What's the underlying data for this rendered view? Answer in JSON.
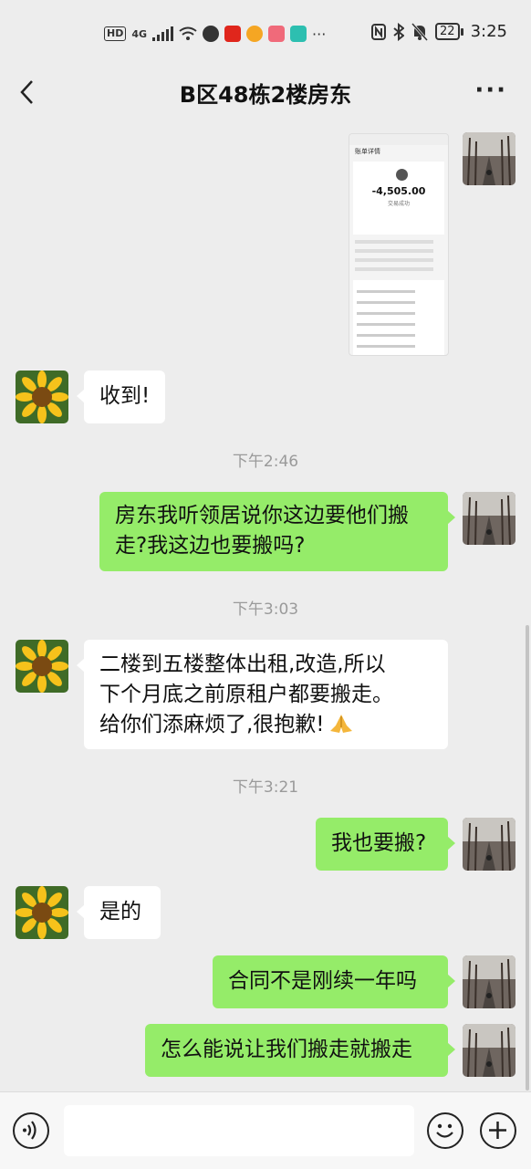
{
  "status_bar": {
    "left_badges": [
      "HD",
      "4G"
    ],
    "battery": "22",
    "time": "3:25",
    "more_indicator": "···"
  },
  "header": {
    "title": "B区48栋2楼房东",
    "more": "···"
  },
  "thumbnail": {
    "header": "账单详情",
    "amount": "-4,505.00",
    "status": "交易成功"
  },
  "messages": [
    {
      "side": "left",
      "text": "收到!"
    },
    {
      "timestamp": "下午2:46"
    },
    {
      "side": "right",
      "lines": [
        "房东我听领居说你这边要他们搬",
        "走?我这边也要搬吗?"
      ]
    },
    {
      "timestamp": "下午3:03"
    },
    {
      "side": "left",
      "lines": [
        "二楼到五楼整体出租,改造,所以",
        "下个月底之前原租户都要搬走。",
        "给你们添麻烦了,很抱歉!"
      ]
    },
    {
      "timestamp": "下午3:21"
    },
    {
      "side": "right",
      "text": "我也要搬?"
    },
    {
      "side": "left",
      "text": "是的"
    },
    {
      "side": "right",
      "text": "合同不是刚续一年吗"
    },
    {
      "side": "right",
      "text": "怎么能说让我们搬走就搬走"
    }
  ],
  "input_bar": {
    "value": "",
    "icons": [
      "voice-icon",
      "emoji-icon",
      "plus-icon"
    ]
  },
  "colors": {
    "self_bubble": "#95ec69",
    "other_bubble": "#ffffff",
    "background": "#ededed"
  }
}
